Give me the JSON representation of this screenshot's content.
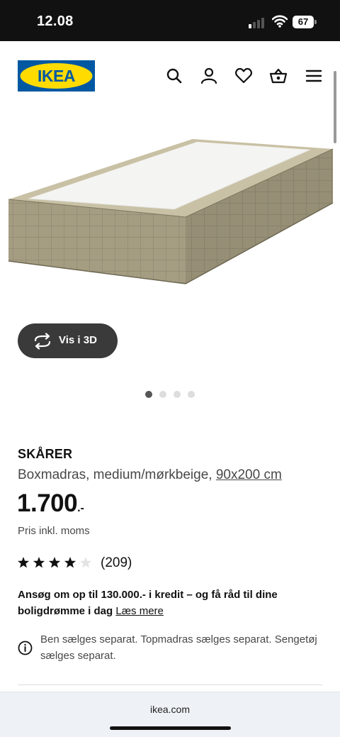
{
  "status_bar": {
    "time": "12.08",
    "battery": "67"
  },
  "header": {
    "logo_text": "IKEA",
    "icons": [
      "search-icon",
      "user-icon",
      "heart-icon",
      "basket-icon",
      "menu-icon"
    ],
    "colors": {
      "logo_blue": "#0058a3",
      "logo_yellow": "#ffdb00"
    }
  },
  "view_3d": {
    "label": "Vis i 3D"
  },
  "carousel": {
    "count": 4,
    "active_index": 0
  },
  "product": {
    "name": "SKÅRER",
    "description": "Boxmadras, medium/mørkbeige,",
    "size_link": "90x200 cm",
    "price_main": "1.700",
    "price_suffix": ".-",
    "vat_note": "Pris inkl. moms",
    "rating": {
      "stars": 4,
      "max": 5,
      "count": "(209)"
    }
  },
  "credit": {
    "text": "Ansøg om op til 130.000.- i kredit – og få råd til dine boligdrømme i dag",
    "link": "Læs mere"
  },
  "info_note": "Ben sælges separat. Topmadras sælges separat. Sengetøj sælges separat.",
  "browser": {
    "url": "ikea.com"
  }
}
